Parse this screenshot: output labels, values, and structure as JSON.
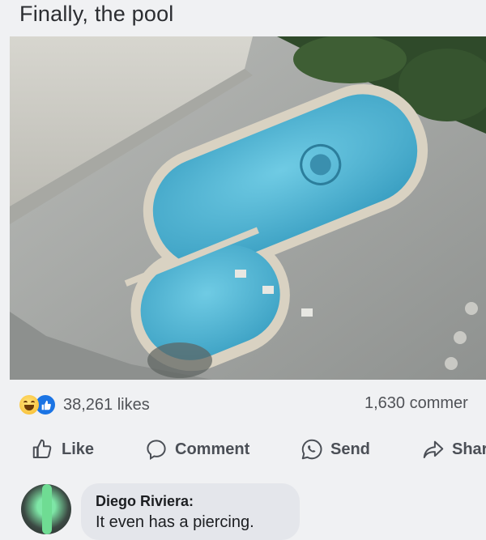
{
  "post": {
    "title": "Finally, the pool",
    "photo_alt": "Aerial view of a swimming pool"
  },
  "stats": {
    "reaction_icons": [
      "haha-icon",
      "like-icon"
    ],
    "likes": "38,261 likes",
    "comments": "1,630 commer"
  },
  "actions": {
    "like": "Like",
    "comment": "Comment",
    "send": "Send",
    "share": "Shar"
  },
  "comment": {
    "author": "Diego Riviera:",
    "text": "It even has a piercing."
  },
  "colors": {
    "accent": "#1b74e4",
    "pool_water": "#4fb3d2",
    "background": "#f0f1f3"
  }
}
